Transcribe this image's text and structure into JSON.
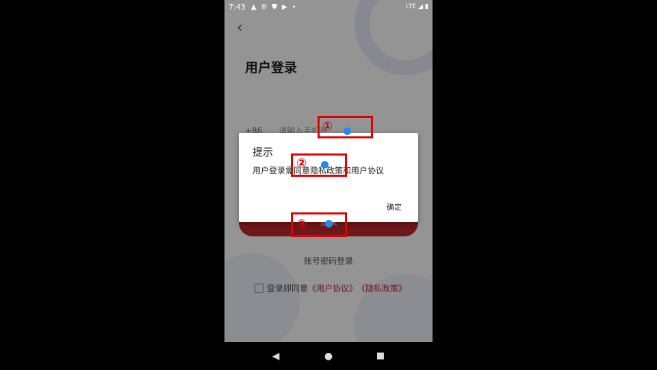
{
  "status_bar": {
    "time": "7:43",
    "network": "LTE",
    "icons": [
      "warning-icon",
      "gear-icon",
      "shield-icon",
      "play-icon",
      "dot-icon",
      "signal-icon",
      "battery-icon"
    ]
  },
  "page": {
    "title": "用户登录",
    "country_code": "+86",
    "phone_placeholder": "请输入手机号",
    "login_button": "登录",
    "password_login": "账号密码登录",
    "agree_prefix": "登录即同意",
    "user_agreement": "《用户协议》",
    "privacy_policy": "《隐私政策》"
  },
  "dialog": {
    "title": "提示",
    "message": "用户登录需同意隐私政策和用户协议",
    "confirm": "确定"
  },
  "annotations": [
    {
      "label": "①"
    },
    {
      "label": "②"
    },
    {
      "label": "③"
    }
  ],
  "colors": {
    "accent": "#c0292f",
    "annotation_red": "#e00000",
    "marker_blue": "#1f8bf0"
  }
}
